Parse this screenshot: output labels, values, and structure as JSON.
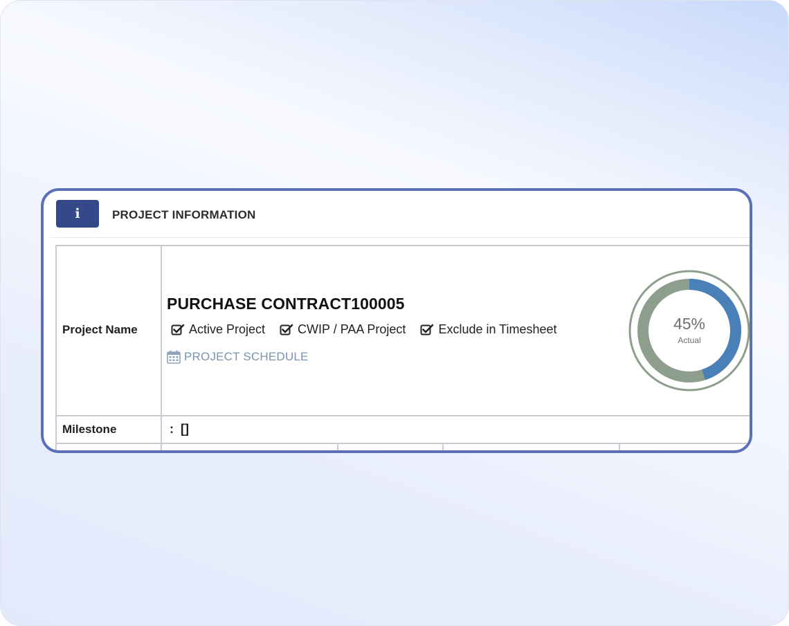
{
  "header": {
    "icon": "info-icon",
    "icon_glyph": "i",
    "title": "PROJECT INFORMATION"
  },
  "project": {
    "name_label": "Project Name",
    "name": "PURCHASE CONTRACT100005",
    "flags": [
      {
        "label": "Active Project",
        "checked": true
      },
      {
        "label": "CWIP / PAA Project",
        "checked": true
      },
      {
        "label": "Exclude in Timesheet",
        "checked": true
      }
    ],
    "schedule_link": "PROJECT SCHEDULE",
    "schedule_icon": "calendar-icon"
  },
  "milestone": {
    "label": "Milestone",
    "value": ":  []"
  },
  "progress": {
    "percent": 45,
    "percent_text": "45%",
    "caption": "Actual",
    "fill_color": "#4a80b8",
    "track_color": "#8d9f8c"
  },
  "colors": {
    "accent": "#34488a",
    "card_border": "#5b70b6",
    "link": "#7a93ad"
  }
}
